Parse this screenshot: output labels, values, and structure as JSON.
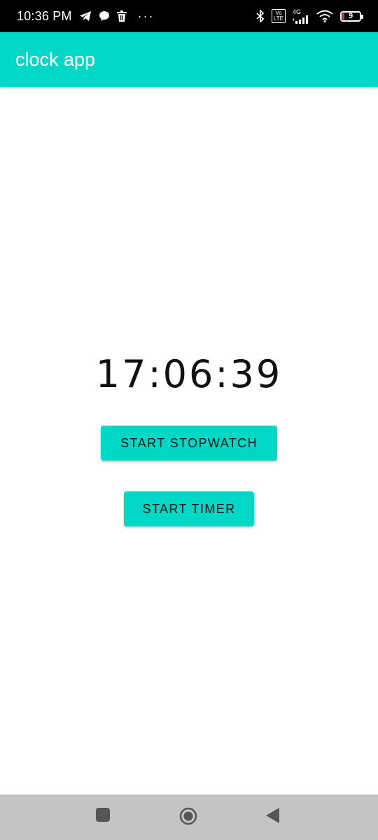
{
  "status_bar": {
    "time": "10:36 PM",
    "dots": "···",
    "network_type": "4G",
    "lte_label_top": "Vo",
    "lte_label_bottom": "LTE",
    "battery_level": "9",
    "battery_color": "#e53935",
    "icons": [
      "telegram-icon",
      "chat-icon",
      "trash-icon",
      "bluetooth-icon",
      "volte-icon",
      "signal-icon",
      "wifi-icon",
      "battery-icon"
    ]
  },
  "app_bar": {
    "title": "clock app",
    "background": "#00d7c4"
  },
  "main": {
    "clock_time": "17:06:39",
    "start_stopwatch_label": "START STOPWATCH",
    "start_timer_label": "START TIMER"
  },
  "nav_bar": {
    "icons": [
      "recents-square-icon",
      "home-circle-icon",
      "back-triangle-icon"
    ]
  }
}
